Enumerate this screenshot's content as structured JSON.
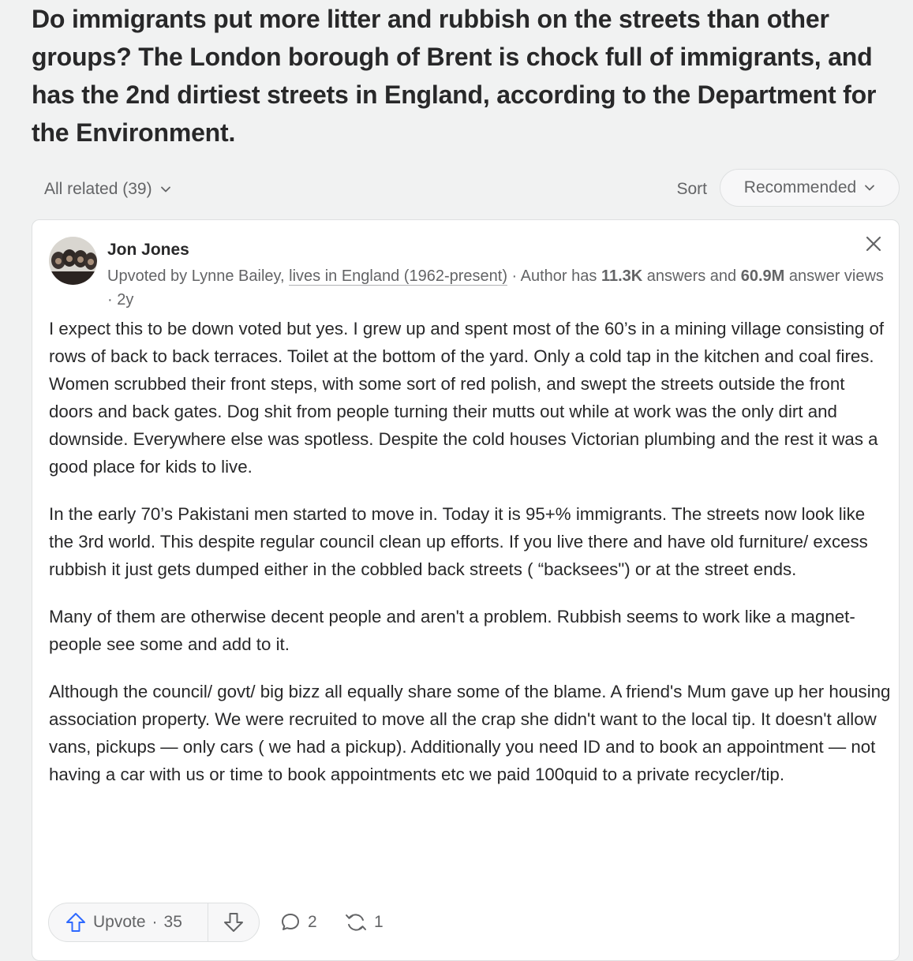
{
  "question": {
    "title": "Do immigrants put more litter and rubbish on the streets than other groups? The London borough of Brent is chock full of immigrants, and has the 2nd dirtiest streets in England, according to the Department for the Environment."
  },
  "filters": {
    "all_related_label": "All related (39)",
    "sort_label": "Sort",
    "sort_value": "Recommended"
  },
  "answer": {
    "author_name": "Jon Jones",
    "upvoted_by": "Upvoted by Lynne Bailey,",
    "credential": "lives in England (1962-present)",
    "author_stats_prefix": " · Author has ",
    "answers_count": "11.3K",
    "answers_mid": " answers and ",
    "views_count": "60.9M",
    "views_suffix": " answer views · 2y",
    "paragraphs": [
      "I expect this to be down voted but yes. I grew up and spent most of the 60’s in a mining village consisting of rows of back to back terraces. Toilet at the bottom of the yard. Only a cold tap in the kitchen and coal fires. Women scrubbed their front steps, with some sort of red polish, and swept the streets outside the front doors and back gates. Dog shit from people turning their mutts out while at work was the only dirt and downside. Everywhere else was spotless. Despite the cold houses Victorian plumbing and the rest it was a good place for kids to live.",
      "In the early 70’s Pakistani men started to move in. Today it is 95+% immigrants. The streets now look like the 3rd world. This despite regular council clean up efforts. If you live there and have old furniture/ excess rubbish it just gets dumped either in the cobbled back streets ( “backsees\") or at the street ends.",
      "Many of them are otherwise decent people and aren't a problem. Rubbish seems to work like a magnet- people see some and add to it.",
      "Although the council/ govt/ big bizz all equally share some of the blame. A friend's Mum gave up her housing association property. We were recruited to move all the crap she didn't want to the local tip. It doesn't allow vans, pickups — only cars ( we had a pickup). Additionally you need ID and to book an appointment — not having a car with us or time to book appointments etc we paid 100quid to a private recycler/tip."
    ]
  },
  "actions": {
    "upvote_label": "Upvote",
    "upvote_count": "35",
    "comments_count": "2",
    "shares_count": "1"
  },
  "icons": {
    "chevron": "chevron-down-icon",
    "close": "close-icon",
    "upvote": "upvote-arrow-icon",
    "downvote": "downvote-arrow-icon",
    "comment": "comment-bubble-icon",
    "share": "share-cycle-icon"
  },
  "colors": {
    "background": "#f1f2f2",
    "card": "#ffffff",
    "text": "#282829",
    "muted": "#636466",
    "accent": "#2e69ff"
  }
}
